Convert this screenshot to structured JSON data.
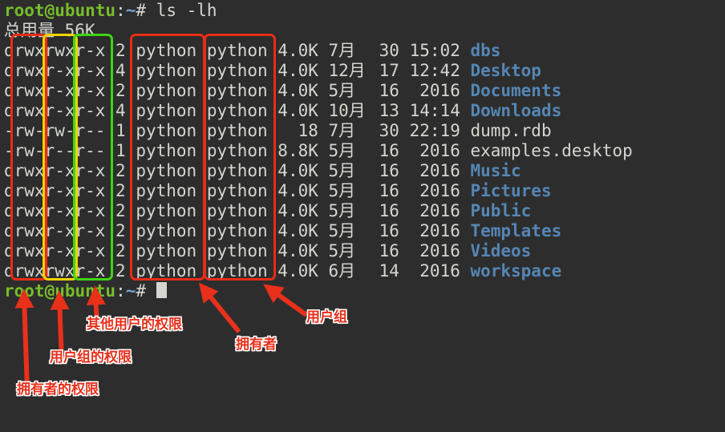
{
  "colors": {
    "background": "#2d2d2d",
    "foreground": "#d3d7cf",
    "prompt_green": "#77bd2a",
    "path_blue": "#72a4d4",
    "dir_blue": "#5586b4",
    "box_red": "#e82c17",
    "box_yellow": "#efd400",
    "box_green": "#3fd414",
    "annotation_red": "#e8301b",
    "cursor": "#d3d7cf"
  },
  "terminal": {
    "prompt_user_host": "root@ubuntu",
    "prompt_separator": ":",
    "prompt_path": "~",
    "prompt_symbol": "#",
    "space": " ",
    "command": "ls -lh",
    "total_label": "总用量",
    "total_value": "56K",
    "files": [
      {
        "perms": "drwxrwxr-x",
        "links": "2",
        "owner": "python",
        "group": "python",
        "size": "4.0K",
        "month": "7月",
        "day": "30",
        "time": "15:02",
        "name": "dbs",
        "type": "dir"
      },
      {
        "perms": "drwxr-xr-x",
        "links": "4",
        "owner": "python",
        "group": "python",
        "size": "4.0K",
        "month": "12月",
        "day": "17",
        "time": "12:42",
        "name": "Desktop",
        "type": "dir"
      },
      {
        "perms": "drwxr-xr-x",
        "links": "2",
        "owner": "python",
        "group": "python",
        "size": "4.0K",
        "month": "5月",
        "day": "16",
        "time": "2016",
        "name": "Documents",
        "type": "dir"
      },
      {
        "perms": "drwxr-xr-x",
        "links": "4",
        "owner": "python",
        "group": "python",
        "size": "4.0K",
        "month": "10月",
        "day": "13",
        "time": "14:14",
        "name": "Downloads",
        "type": "dir"
      },
      {
        "perms": "-rw-rw-r--",
        "links": "1",
        "owner": "python",
        "group": "python",
        "size": "18",
        "month": "7月",
        "day": "30",
        "time": "22:19",
        "name": "dump.rdb",
        "type": "file"
      },
      {
        "perms": "-rw-r--r--",
        "links": "1",
        "owner": "python",
        "group": "python",
        "size": "8.8K",
        "month": "5月",
        "day": "16",
        "time": "2016",
        "name": "examples.desktop",
        "type": "file"
      },
      {
        "perms": "drwxr-xr-x",
        "links": "2",
        "owner": "python",
        "group": "python",
        "size": "4.0K",
        "month": "5月",
        "day": "16",
        "time": "2016",
        "name": "Music",
        "type": "dir"
      },
      {
        "perms": "drwxr-xr-x",
        "links": "2",
        "owner": "python",
        "group": "python",
        "size": "4.0K",
        "month": "5月",
        "day": "16",
        "time": "2016",
        "name": "Pictures",
        "type": "dir"
      },
      {
        "perms": "drwxr-xr-x",
        "links": "2",
        "owner": "python",
        "group": "python",
        "size": "4.0K",
        "month": "5月",
        "day": "16",
        "time": "2016",
        "name": "Public",
        "type": "dir"
      },
      {
        "perms": "drwxr-xr-x",
        "links": "2",
        "owner": "python",
        "group": "python",
        "size": "4.0K",
        "month": "5月",
        "day": "16",
        "time": "2016",
        "name": "Templates",
        "type": "dir"
      },
      {
        "perms": "drwxr-xr-x",
        "links": "2",
        "owner": "python",
        "group": "python",
        "size": "4.0K",
        "month": "5月",
        "day": "16",
        "time": "2016",
        "name": "Videos",
        "type": "dir"
      },
      {
        "perms": "drwxrwxr-x",
        "links": "2",
        "owner": "python",
        "group": "python",
        "size": "4.0K",
        "month": "6月",
        "day": "14",
        "time": "2016",
        "name": "workspace",
        "type": "dir"
      }
    ]
  },
  "annotations": {
    "labels": {
      "owner_perms": "拥有者的权限",
      "group_perms": "用户组的权限",
      "other_perms": "其他用户的权限",
      "owner": "拥有者",
      "group": "用户组"
    }
  }
}
